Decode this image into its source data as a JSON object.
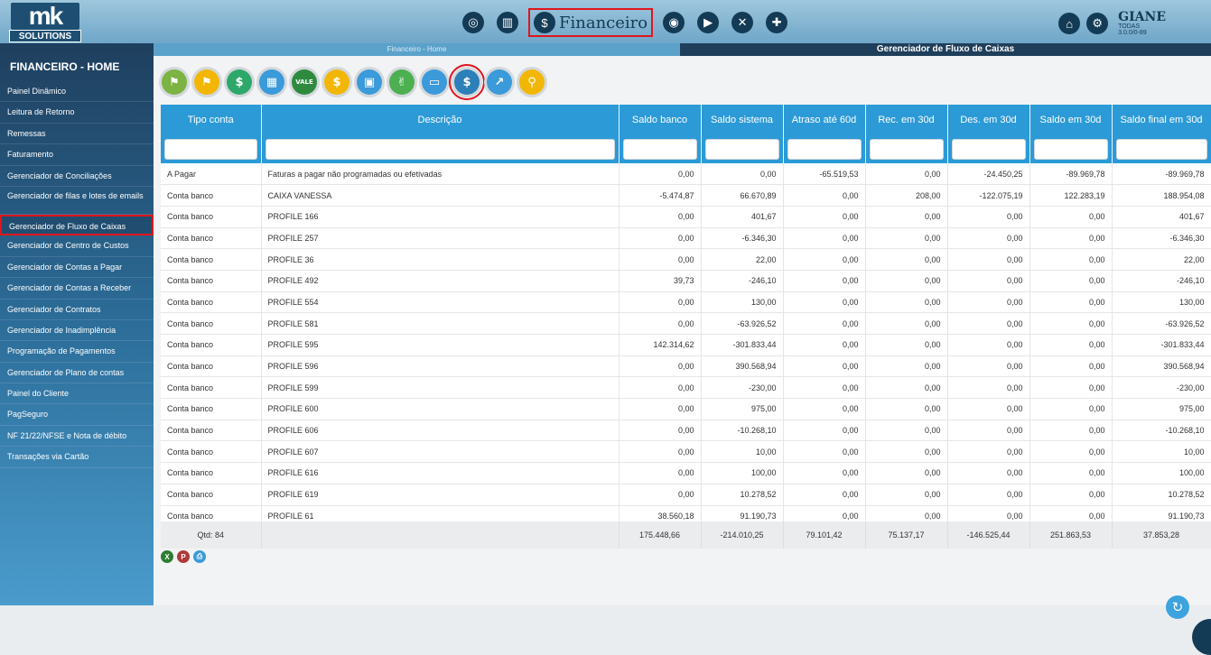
{
  "logo": {
    "mark": "mk",
    "sub": "SOLUTIONS"
  },
  "topnav": {
    "module_label": "Financeiro",
    "icons": [
      "target-icon",
      "chart-icon",
      "money-bag-icon",
      "eye-icon",
      "truck-icon",
      "tools-icon",
      "puzzle-icon"
    ]
  },
  "user": {
    "name": "GIANE",
    "company": "TODAS",
    "version": "3.0.0/0-89"
  },
  "breadcrumb": "Financeiro - Home",
  "page_title": "Gerenciador de Fluxo de Caixas",
  "sidebar": {
    "title": "FINANCEIRO - HOME",
    "items": [
      {
        "label": "Painel Dinâmico"
      },
      {
        "label": "Leitura de Retorno"
      },
      {
        "label": "Remessas"
      },
      {
        "label": "Faturamento"
      },
      {
        "label": "Gerenciador de Conciliações"
      },
      {
        "label": "Gerenciador de filas e lotes de emails"
      },
      {
        "label": "Gerenciador de Fluxo de Caixas"
      },
      {
        "label": "Gerenciador de Centro de Custos"
      },
      {
        "label": "Gerenciador de Contas a Pagar"
      },
      {
        "label": "Gerenciador de Contas a Receber"
      },
      {
        "label": "Gerenciador de Contratos"
      },
      {
        "label": "Gerenciador de Inadimplência"
      },
      {
        "label": "Programação de Pagamentos"
      },
      {
        "label": "Gerenciador de Plano de contas"
      },
      {
        "label": "Painel do Cliente"
      },
      {
        "label": "PagSeguro"
      },
      {
        "label": "NF 21/22/NFSE e Nota de débito"
      },
      {
        "label": "Transações via Cartão"
      }
    ]
  },
  "toolbar": {
    "icons": [
      {
        "name": "flag-green-icon",
        "glyph": "⚑",
        "color": "#7cb342"
      },
      {
        "name": "flag-yellow-icon",
        "glyph": "⚑",
        "color": "#f2b705"
      },
      {
        "name": "dollar-icon",
        "glyph": "$",
        "color": "#2ea86a"
      },
      {
        "name": "building-icon",
        "glyph": "▦",
        "color": "#3b9ad9"
      },
      {
        "name": "vale-icon",
        "glyph": "VALE",
        "color": "#2e8b3e"
      },
      {
        "name": "dollar-transfer-icon",
        "glyph": "$",
        "color": "#f2b705"
      },
      {
        "name": "safe-icon",
        "glyph": "▣",
        "color": "#3b9ad9"
      },
      {
        "name": "handshake-icon",
        "glyph": "✌",
        "color": "#4caf50"
      },
      {
        "name": "card-icon",
        "glyph": "▭",
        "color": "#3b9ad9"
      },
      {
        "name": "search-money-icon",
        "glyph": "$",
        "color": "#2c7fb8"
      },
      {
        "name": "growth-chart-icon",
        "glyph": "↗",
        "color": "#3b9ad9"
      },
      {
        "name": "coins-icon",
        "glyph": "⚲",
        "color": "#f2b705"
      }
    ]
  },
  "table": {
    "columns": [
      "Tipo conta",
      "Descrição",
      "Saldo banco",
      "Saldo sistema",
      "Atraso até 60d",
      "Rec. em 30d",
      "Des. em 30d",
      "Saldo em 30d",
      "Saldo final em 30d"
    ],
    "rows": [
      [
        "A Pagar",
        "Faturas a pagar não programadas ou efetivadas",
        "0,00",
        "0,00",
        "-65.519,53",
        "0,00",
        "-24.450,25",
        "-89.969,78",
        "-89.969,78"
      ],
      [
        "Conta banco",
        "CAIXA VANESSA",
        "-5.474,87",
        "66.670,89",
        "0,00",
        "208,00",
        "-122.075,19",
        "122.283,19",
        "188.954,08"
      ],
      [
        "Conta banco",
        "PROFILE 166",
        "0,00",
        "401,67",
        "0,00",
        "0,00",
        "0,00",
        "0,00",
        "401,67"
      ],
      [
        "Conta banco",
        "PROFILE 257",
        "0,00",
        "-6.346,30",
        "0,00",
        "0,00",
        "0,00",
        "0,00",
        "-6.346,30"
      ],
      [
        "Conta banco",
        "PROFILE 36",
        "0,00",
        "22,00",
        "0,00",
        "0,00",
        "0,00",
        "0,00",
        "22,00"
      ],
      [
        "Conta banco",
        "PROFILE 492",
        "39,73",
        "-246,10",
        "0,00",
        "0,00",
        "0,00",
        "0,00",
        "-246,10"
      ],
      [
        "Conta banco",
        "PROFILE 554",
        "0,00",
        "130,00",
        "0,00",
        "0,00",
        "0,00",
        "0,00",
        "130,00"
      ],
      [
        "Conta banco",
        "PROFILE 581",
        "0,00",
        "-63.926,52",
        "0,00",
        "0,00",
        "0,00",
        "0,00",
        "-63.926,52"
      ],
      [
        "Conta banco",
        "PROFILE 595",
        "142.314,62",
        "-301.833,44",
        "0,00",
        "0,00",
        "0,00",
        "0,00",
        "-301.833,44"
      ],
      [
        "Conta banco",
        "PROFILE 596",
        "0,00",
        "390.568,94",
        "0,00",
        "0,00",
        "0,00",
        "0,00",
        "390.568,94"
      ],
      [
        "Conta banco",
        "PROFILE 599",
        "0,00",
        "-230,00",
        "0,00",
        "0,00",
        "0,00",
        "0,00",
        "-230,00"
      ],
      [
        "Conta banco",
        "PROFILE 600",
        "0,00",
        "975,00",
        "0,00",
        "0,00",
        "0,00",
        "0,00",
        "975,00"
      ],
      [
        "Conta banco",
        "PROFILE 606",
        "0,00",
        "-10.268,10",
        "0,00",
        "0,00",
        "0,00",
        "0,00",
        "-10.268,10"
      ],
      [
        "Conta banco",
        "PROFILE 607",
        "0,00",
        "10,00",
        "0,00",
        "0,00",
        "0,00",
        "0,00",
        "10,00"
      ],
      [
        "Conta banco",
        "PROFILE 616",
        "0,00",
        "100,00",
        "0,00",
        "0,00",
        "0,00",
        "0,00",
        "100,00"
      ],
      [
        "Conta banco",
        "PROFILE 619",
        "0,00",
        "10.278,52",
        "0,00",
        "0,00",
        "0,00",
        "0,00",
        "10.278,52"
      ],
      [
        "Conta banco",
        "PROFILE 61",
        "38.560,18",
        "91.190,73",
        "0,00",
        "0,00",
        "0,00",
        "0,00",
        "91.190,73"
      ]
    ],
    "totals": [
      "Qtd: 84",
      "",
      "175.448,66",
      "-214.010,25",
      "79.101,42",
      "75.137,17",
      "-146.525,44",
      "251.863,53",
      "37.853,28"
    ]
  },
  "footer_icons": [
    {
      "name": "excel-export-icon",
      "glyph": "X",
      "color": "#2e7d32"
    },
    {
      "name": "pdf-export-icon",
      "glyph": "P",
      "color": "#b03a3a"
    },
    {
      "name": "print-icon",
      "glyph": "⎙",
      "color": "#3b9ad9"
    }
  ],
  "colors": {
    "accent": "#2c9ad6",
    "highlight": "#e0151c",
    "navy": "#143b56"
  }
}
